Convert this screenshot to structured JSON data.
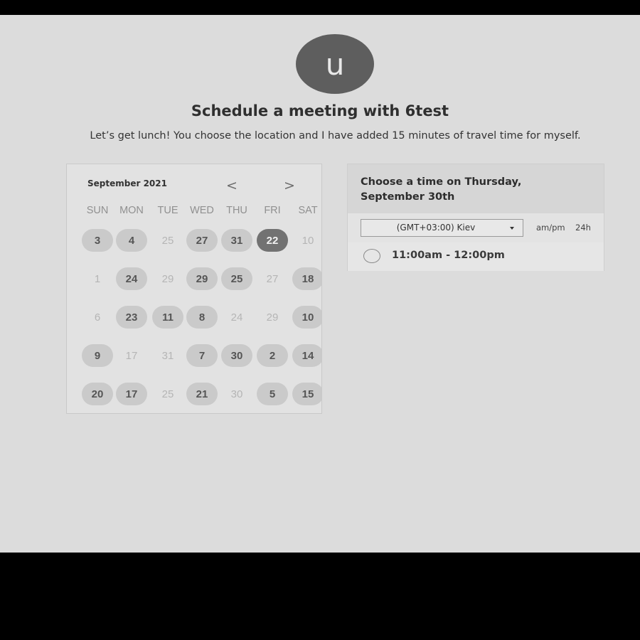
{
  "header": {
    "avatar_letter": "u",
    "title": "Schedule a meeting with 6test",
    "description": "Let’s get lunch! You choose the location and I have added 15 minutes of travel time for myself."
  },
  "calendar": {
    "month_label": "September 2021",
    "prev_icon": "<",
    "next_icon": ">",
    "weekdays": [
      "SUN",
      "MON",
      "TUE",
      "WED",
      "THU",
      "FRI",
      "SAT"
    ],
    "weeks": [
      [
        {
          "day": "3",
          "available": true
        },
        {
          "day": "4",
          "available": true
        },
        {
          "day": "25",
          "available": false
        },
        {
          "day": "27",
          "available": true
        },
        {
          "day": "31",
          "available": true
        },
        {
          "day": "22",
          "available": true,
          "selected": true
        },
        {
          "day": "10",
          "available": false
        }
      ],
      [
        {
          "day": "1",
          "available": false
        },
        {
          "day": "24",
          "available": true
        },
        {
          "day": "29",
          "available": false
        },
        {
          "day": "29",
          "available": true
        },
        {
          "day": "25",
          "available": true
        },
        {
          "day": "27",
          "available": false
        },
        {
          "day": "18",
          "available": true
        }
      ],
      [
        {
          "day": "6",
          "available": false
        },
        {
          "day": "23",
          "available": true
        },
        {
          "day": "11",
          "available": true
        },
        {
          "day": "8",
          "available": true
        },
        {
          "day": "24",
          "available": false
        },
        {
          "day": "29",
          "available": false
        },
        {
          "day": "10",
          "available": true
        }
      ],
      [
        {
          "day": "9",
          "available": true
        },
        {
          "day": "17",
          "available": false
        },
        {
          "day": "31",
          "available": false
        },
        {
          "day": "7",
          "available": true
        },
        {
          "day": "30",
          "available": true
        },
        {
          "day": "2",
          "available": true
        },
        {
          "day": "14",
          "available": true
        }
      ],
      [
        {
          "day": "20",
          "available": true
        },
        {
          "day": "17",
          "available": true
        },
        {
          "day": "25",
          "available": false
        },
        {
          "day": "21",
          "available": true
        },
        {
          "day": "30",
          "available": false
        },
        {
          "day": "5",
          "available": true
        },
        {
          "day": "15",
          "available": true
        }
      ]
    ]
  },
  "time_panel": {
    "heading": "Choose a time on Thursday, September 30th",
    "timezone_value": "(GMT+03:00) Kiev",
    "format_ampm": "am/pm",
    "format_24h": "24h",
    "slots": [
      "11:00am - 12:00pm"
    ]
  },
  "colors": {
    "available_day_bg": "#cacaca",
    "selected_day_bg": "#727272",
    "page_bg": "#dcdcdc"
  }
}
